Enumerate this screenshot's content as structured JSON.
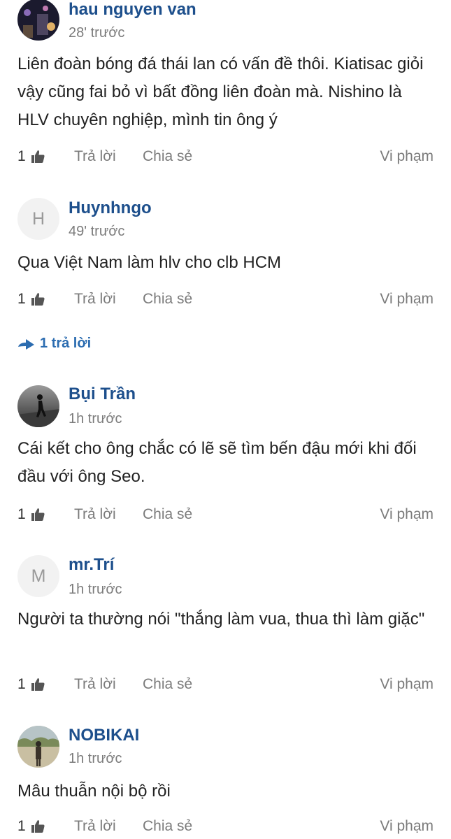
{
  "comments": [
    {
      "author": "hau nguyen van",
      "avatar_icon": "user-photo-night-city",
      "time": "28' trước",
      "text": "Liên đoàn bóng đá thái lan có vấn đề thôi. Kiatisac giỏi vậy cũng fai bỏ vì bất đồng liên đoàn mà. Nishino là HLV chuyên nghiệp, mình tin ông ý",
      "likes": "1",
      "reply_label": "Trả lời",
      "share_label": "Chia sẻ",
      "report_label": "Vi phạm"
    },
    {
      "author": "Huynhngo",
      "avatar_letter": "H",
      "time": "49' trước",
      "text": "Qua Việt Nam làm hlv cho clb HCM",
      "likes": "1",
      "reply_label": "Trả lời",
      "share_label": "Chia sẻ",
      "report_label": "Vi phạm",
      "replies_toggle": "1 trả lời"
    },
    {
      "author": "Bụi Trần",
      "avatar_icon": "user-photo-runner",
      "time": "1h trước",
      "text": "Cái kết cho ông chắc có lẽ sẽ tìm bến đậu mới khi đối đầu với ông Seo.",
      "likes": "1",
      "reply_label": "Trả lời",
      "share_label": "Chia sẻ",
      "report_label": "Vi phạm"
    },
    {
      "author": "mr.Trí",
      "avatar_letter": "M",
      "time": "1h trước",
      "text": "Người ta thường nói \"thắng làm vua, thua thì làm giặc\"",
      "likes": "1",
      "reply_label": "Trả lời",
      "share_label": "Chia sẻ",
      "report_label": "Vi phạm"
    },
    {
      "author": "NOBIKAI",
      "avatar_icon": "user-photo-outdoor",
      "time": "1h trước",
      "text": "Mâu thuẫn nội bộ rồi",
      "likes": "1",
      "reply_label": "Trả lời",
      "share_label": "Chia sẻ",
      "report_label": "Vi phạm"
    }
  ],
  "colors": {
    "author": "#1d4f8c",
    "meta": "#7b7b7b",
    "link": "#2b6cb0",
    "text": "#222222"
  }
}
